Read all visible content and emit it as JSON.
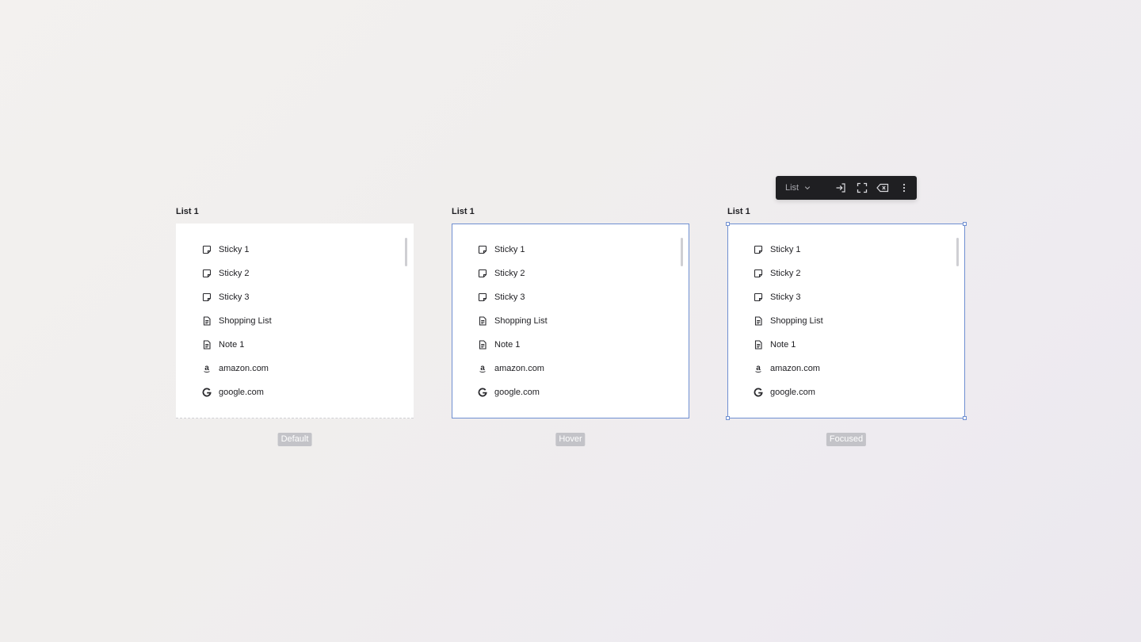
{
  "panels": [
    {
      "title": "List 1",
      "state_label": "Default",
      "items": [
        {
          "label": "Sticky 1",
          "icon": "sticky-icon"
        },
        {
          "label": "Sticky 2",
          "icon": "sticky-icon"
        },
        {
          "label": "Sticky 3",
          "icon": "sticky-icon"
        },
        {
          "label": "Shopping List",
          "icon": "document-icon"
        },
        {
          "label": "Note 1",
          "icon": "document-icon"
        },
        {
          "label": "amazon.com",
          "icon": "amazon-icon"
        },
        {
          "label": "google.com",
          "icon": "google-icon"
        }
      ]
    },
    {
      "title": "List 1",
      "state_label": "Hover",
      "items": [
        {
          "label": "Sticky 1",
          "icon": "sticky-icon"
        },
        {
          "label": "Sticky 2",
          "icon": "sticky-icon"
        },
        {
          "label": "Sticky 3",
          "icon": "sticky-icon"
        },
        {
          "label": "Shopping List",
          "icon": "document-icon"
        },
        {
          "label": "Note 1",
          "icon": "document-icon"
        },
        {
          "label": "amazon.com",
          "icon": "amazon-icon"
        },
        {
          "label": "google.com",
          "icon": "google-icon"
        }
      ]
    },
    {
      "title": "List 1",
      "state_label": "Focused",
      "items": [
        {
          "label": "Sticky 1",
          "icon": "sticky-icon"
        },
        {
          "label": "Sticky 2",
          "icon": "sticky-icon"
        },
        {
          "label": "Sticky 3",
          "icon": "sticky-icon"
        },
        {
          "label": "Shopping List",
          "icon": "document-icon"
        },
        {
          "label": "Note 1",
          "icon": "document-icon"
        },
        {
          "label": "amazon.com",
          "icon": "amazon-icon"
        },
        {
          "label": "google.com",
          "icon": "google-icon"
        }
      ]
    }
  ],
  "toolbar": {
    "view_select_label": "List",
    "buttons": [
      "open-in-icon",
      "expand-icon",
      "delete-icon",
      "more-vertical-icon"
    ]
  },
  "colors": {
    "focus_border": "#6f8fd1",
    "toolbar_bg": "#1f1f22",
    "state_label_bg": "#c3c3c8"
  }
}
